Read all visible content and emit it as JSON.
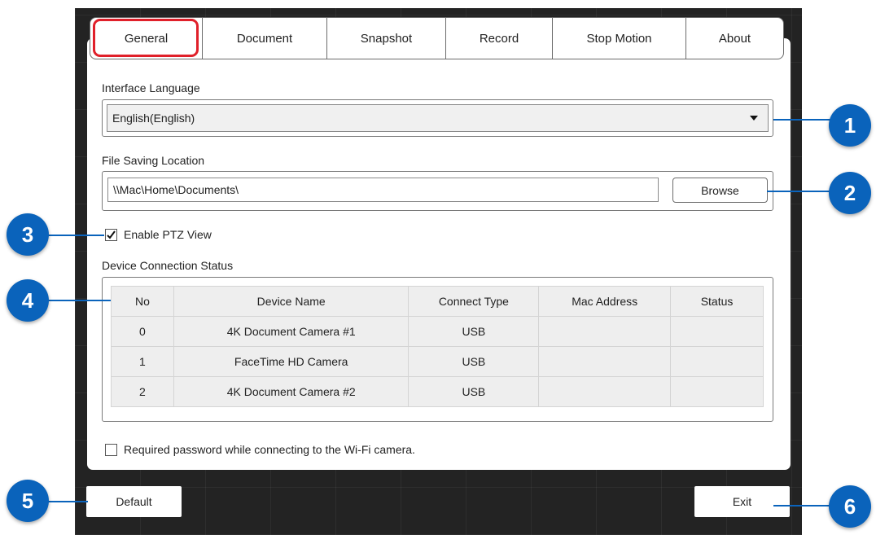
{
  "tabs": [
    {
      "label": "General",
      "active": true
    },
    {
      "label": "Document"
    },
    {
      "label": "Snapshot"
    },
    {
      "label": "Record"
    },
    {
      "label": "Stop Motion"
    },
    {
      "label": "About"
    }
  ],
  "interface_language": {
    "label": "Interface Language",
    "value": "English(English)"
  },
  "file_saving": {
    "label": "File Saving Location",
    "value": "\\\\Mac\\Home\\Documents\\",
    "browse_label": "Browse"
  },
  "ptz": {
    "label": "Enable PTZ View",
    "checked": true
  },
  "devices": {
    "label": "Device Connection Status",
    "columns": [
      "No",
      "Device Name",
      "Connect Type",
      "Mac Address",
      "Status"
    ],
    "rows": [
      [
        "0",
        "4K Document Camera #1",
        "USB",
        "",
        ""
      ],
      [
        "1",
        "FaceTime HD Camera",
        "USB",
        "",
        ""
      ],
      [
        "2",
        "4K Document Camera #2",
        "USB",
        "",
        ""
      ]
    ]
  },
  "wifi_password": {
    "label": "Required password while connecting to the Wi-Fi camera.",
    "checked": false
  },
  "buttons": {
    "default_label": "Default",
    "exit_label": "Exit"
  },
  "callouts": [
    "1",
    "2",
    "3",
    "4",
    "5",
    "6"
  ],
  "colors": {
    "callout": "#0a63bb",
    "active_tab_outline": "#e0202a",
    "background": "#232323"
  }
}
